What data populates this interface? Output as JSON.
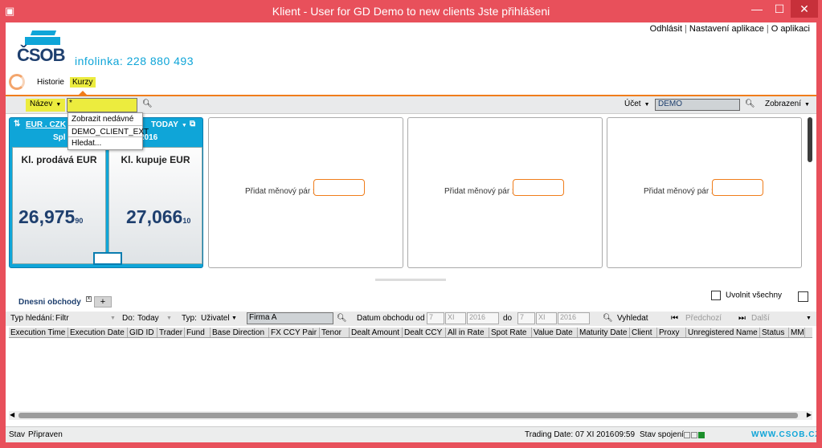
{
  "window": {
    "title": "Klient - User for GD Demo to new clients Jste přihlášeni",
    "min": "—",
    "max": "☐",
    "close": "✕"
  },
  "header": {
    "links": [
      "Odhlásit",
      "Nastavení aplikace",
      "O aplikaci"
    ],
    "logo": "ČSOB",
    "hotline": "infolinka: 228 880 493"
  },
  "nav": {
    "tabs": [
      "Historie",
      "Kurzy"
    ],
    "active": "Kurzy"
  },
  "toolbar": {
    "nazev_label": "Název",
    "search_value": "*",
    "ucet_label": "Účet",
    "ucet_value": "DEMO",
    "zobrazeni_label": "Zobrazení"
  },
  "dropdown": {
    "items": [
      "Zobrazit nedávné",
      "DEMO_CLIENT_EXT",
      "Hledat..."
    ]
  },
  "fx_tile": {
    "pair": "EUR . CZK",
    "tenor": "TODAY",
    "sub_left": "Spl",
    "sub_right": "2016",
    "sell_label": "Kl. prodává EUR",
    "sell_price_main": "26,975",
    "sell_price_small": "90",
    "buy_label": "Kl. kupuje EUR",
    "buy_price_main": "27,066",
    "buy_price_small": "10"
  },
  "empty_tiles": {
    "label": "Přidat měnový pár :"
  },
  "trades": {
    "title": "Dnesni obchody",
    "tab_plus": "+",
    "release_all": "Uvolnit všechny",
    "filter": {
      "typ_hledani_label": "Typ hledání:",
      "typ_hledani_value": "Filtr",
      "do_label": "Do:",
      "do_value": "Today",
      "typ_label": "Typ:",
      "typ_value": "Uživatel",
      "firma_value": "Firma A",
      "datum_label": "Datum obchodu od",
      "from_day": "7",
      "from_month": "XI",
      "from_year": "2016",
      "to_label": "do",
      "to_day": "7",
      "to_month": "XI",
      "to_year": "2016",
      "search_btn": "Vyhledat",
      "prev_btn": "Předchozí",
      "next_btn": "Další"
    },
    "columns": [
      "Execution Time",
      "Execution Date",
      "GID ID",
      "Trader",
      "Fund",
      "Base Direction",
      "FX CCY Pair",
      "Tenor",
      "Dealt Amount",
      "Dealt CCY",
      "All in Rate",
      "Spot Rate",
      "Value Date",
      "Maturity Date",
      "Client",
      "Proxy",
      "Unregistered Name",
      "Status",
      "MM"
    ]
  },
  "status": {
    "stav_label": "Stav",
    "stav_value": "Připraven",
    "trading_date": "Trading Date: 07 XI 2016",
    "time": "09:59",
    "connection_label": "Stav spojení",
    "website": "WWW.CSOB.CZ"
  },
  "colors": {
    "titlebar": "#e8505b",
    "accent_orange": "#f07d1b",
    "highlight_yellow": "#ecec3e",
    "csob_blue": "#0fa5d8",
    "dark_blue": "#1e3f6e"
  }
}
